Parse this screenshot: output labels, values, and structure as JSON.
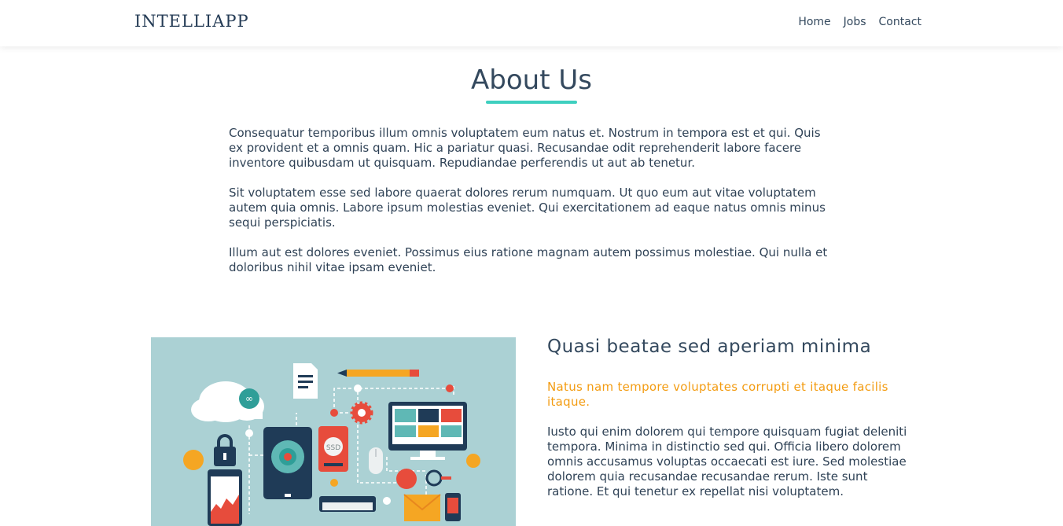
{
  "navbar": {
    "brand": "INTELLIAPP",
    "links": [
      "Home",
      "Jobs",
      "Contact"
    ]
  },
  "about": {
    "title": "About Us",
    "paragraphs": [
      "Consequatur temporibus illum omnis voluptatem eum natus et. Nostrum in tempora est et qui. Quis ex provident et a omnis quam. Hic a pariatur quasi. Recusandae odit reprehenderit labore facere inventore quibusdam ut quisquam. Repudiandae perferendis ut aut ab tenetur.",
      "Sit voluptatem esse sed labore quaerat dolores rerum numquam. Ut quo eum aut vitae voluptatem autem quia omnis. Labore ipsum molestias eveniet. Qui exercitationem ad eaque natus omnis minus sequi perspiciatis.",
      "Illum aut est dolores eveniet. Possimus eius ratione magnam autem possimus molestiae. Qui nulla et doloribus nihil vitae ipsam eveniet."
    ]
  },
  "feature": {
    "title": "Quasi beatae sed aperiam minima",
    "subtitle": "Natus nam tempore voluptates corrupti et itaque facilis itaque.",
    "body": "Iusto qui enim dolorem qui tempore quisquam fugiat deleniti tempora. Minima in distinctio sed qui. Officia libero dolorem omnis accusamus voluptas occaecati est iure. Sed molestiae dolorem quia recusandae recusandae rerum. Iste sunt ratione. Et qui tenetur ex repellat nisi voluptatem.",
    "illustration": {
      "ssd_label": "SSD",
      "colors": {
        "background": "#abd1d4",
        "navy": "#1f3b57",
        "orange": "#f5a623",
        "red": "#e74c3c",
        "white": "#ffffff"
      }
    }
  },
  "theme": {
    "accent": "#3ecfbf",
    "highlight": "#f39c12"
  }
}
